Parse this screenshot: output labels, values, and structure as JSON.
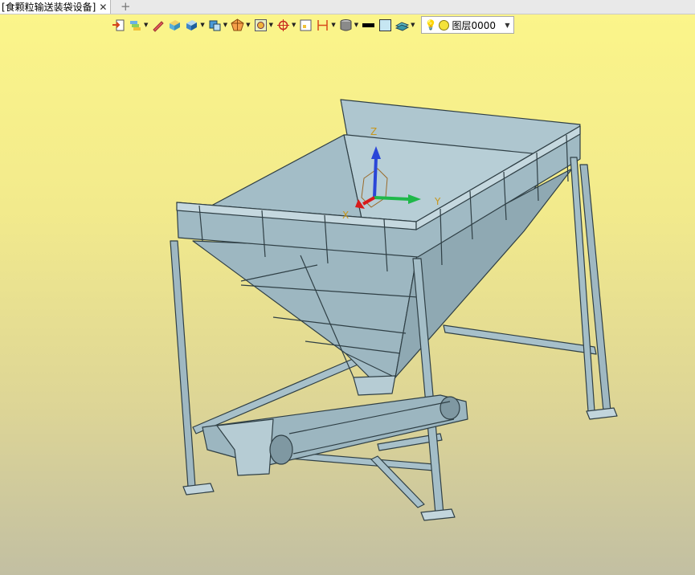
{
  "document_tab": {
    "title": "[食颗粒输送装袋设备]",
    "close_glyph": "✕"
  },
  "new_tab": {
    "glyph": "+"
  },
  "toolbar": {
    "tools": [
      {
        "icon": "import-icon"
      },
      {
        "icon": "layers-stack-icon"
      },
      {
        "icon": "pencil-icon"
      },
      {
        "icon": "solid-box-icon"
      },
      {
        "icon": "shaded-cube-icon"
      },
      {
        "icon": "view-orientation-icon"
      },
      {
        "icon": "render-mode-icon"
      },
      {
        "icon": "zoom-fit-icon"
      },
      {
        "icon": "snap-target-icon"
      },
      {
        "icon": "sheet-icon"
      },
      {
        "icon": "dimension-icon"
      },
      {
        "icon": "material-bucket-icon"
      },
      {
        "icon": "line-color-icon"
      },
      {
        "icon": "fill-color-icon"
      },
      {
        "icon": "surface-style-icon"
      }
    ],
    "layer_select": {
      "value": "图层0000",
      "bulb_icon": "lightbulb-icon",
      "state_icon": "sun-icon"
    }
  },
  "axes": {
    "z": "Z",
    "y": "Y",
    "x": "X"
  },
  "colors": {
    "model_fill": "#a9c4ce",
    "model_edge": "#2f3f45",
    "axis_x": "#d81b1b",
    "axis_y": "#1fb84a",
    "axis_z": "#2a46d8"
  }
}
